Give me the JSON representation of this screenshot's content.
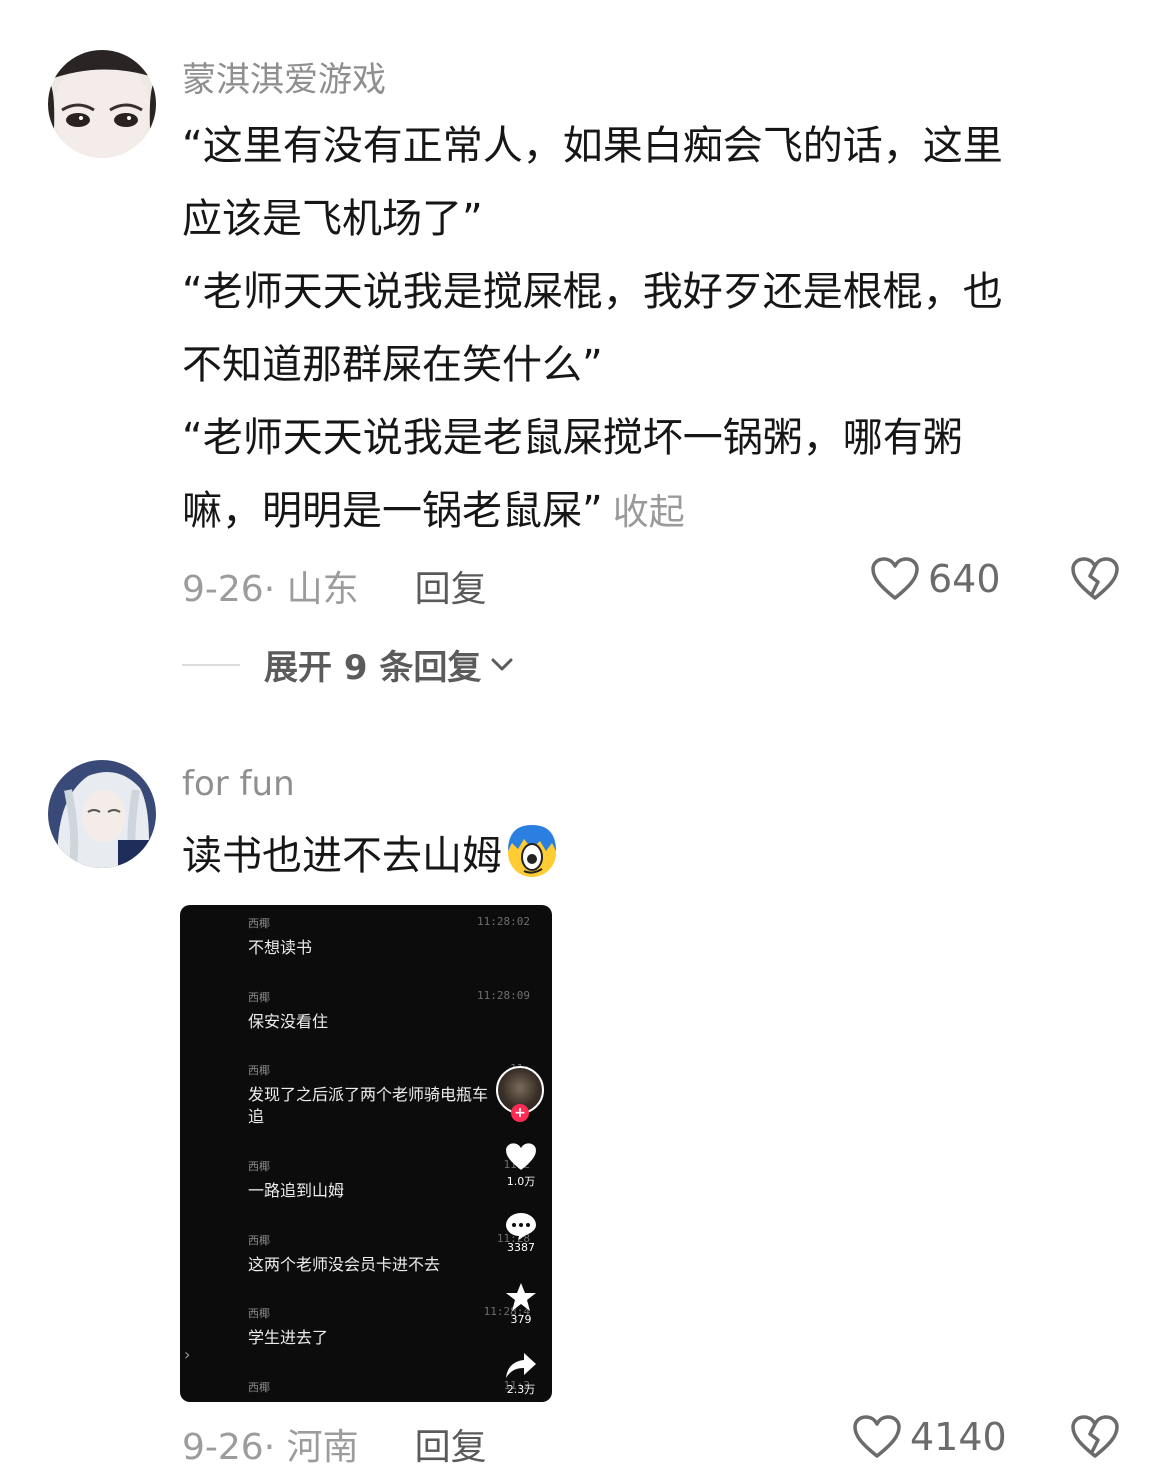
{
  "comments": [
    {
      "username": "蒙淇淇爱游戏",
      "lines": [
        "“这里有没有正常人，如果白痴会飞的话，这里",
        "应该是飞机场了”",
        "“老师天天说我是搅屎棍，我好歹还是根棍，也",
        "不知道那群屎在笑什么”",
        "“老师天天说我是老鼠屎搅坏一锅粥，哪有粥",
        "嘛，明明是一锅老鼠屎”"
      ],
      "collapse_label": "收起",
      "date_location": "9-26· 山东",
      "reply_label": "回复",
      "likes": "640",
      "expand_label": "展开 9 条回复"
    },
    {
      "username": "for fun",
      "text": "读书也进不去山姆",
      "date_location": "9-26· 河南",
      "reply_label": "回复",
      "likes": "4140",
      "video": {
        "messages": [
          {
            "sender": "西椰",
            "time": "11:28:02",
            "text": "不想读书"
          },
          {
            "sender": "西椰",
            "time": "11:28:09",
            "text": "保安没看住"
          },
          {
            "sender": "西椰",
            "time": "11:",
            "text": "发现了之后派了两个老师骑电瓶车追"
          },
          {
            "sender": "西椰",
            "time": "11:2",
            "text": "一路追到山姆"
          },
          {
            "sender": "西椰",
            "time": "11:28",
            "text": "这两个老师没会员卡进不去"
          },
          {
            "sender": "西椰",
            "time": "11:28:4",
            "text": "学生进去了"
          },
          {
            "sender": "西椰",
            "time": "11:2",
            "text": ""
          }
        ],
        "like_count": "1.0万",
        "comment_count": "3387",
        "favorite_count": "379",
        "share_count": "2.3万"
      }
    }
  ],
  "colors": {
    "text": "#161616",
    "muted": "#9c9c9c",
    "video_bg": "#0c0c0c",
    "follow_red": "#fe2c55"
  }
}
